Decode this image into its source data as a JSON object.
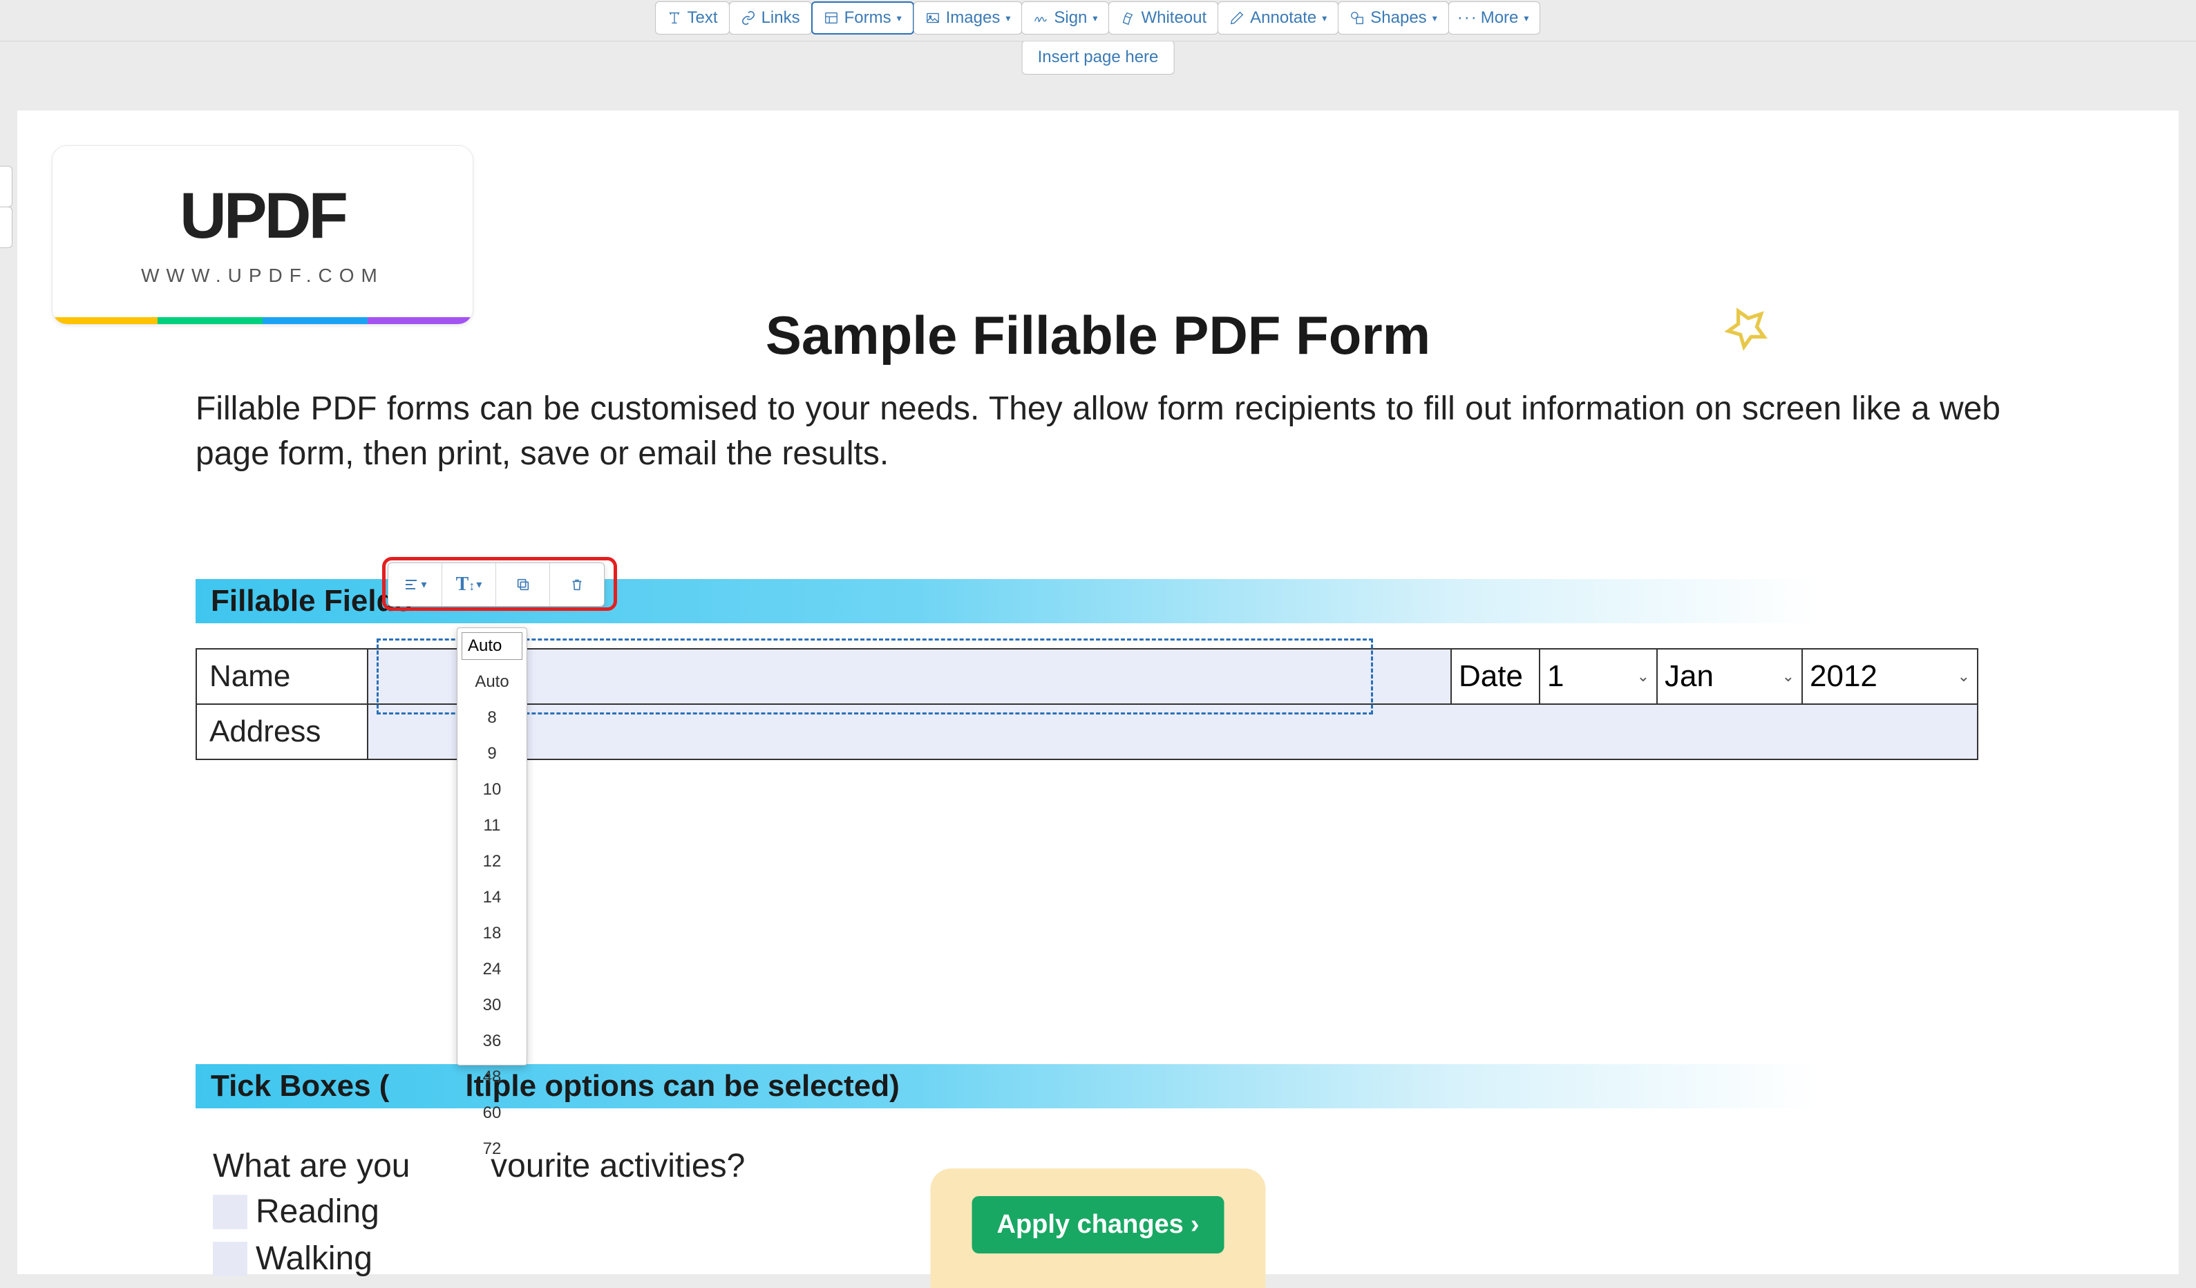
{
  "toolbar": {
    "text": "Text",
    "links": "Links",
    "forms": "Forms",
    "images": "Images",
    "sign": "Sign",
    "whiteout": "Whiteout",
    "annotate": "Annotate",
    "shapes": "Shapes",
    "more": "More"
  },
  "insert_page": "Insert page here",
  "logo": {
    "brand": "UPDF",
    "url": "WWW.UPDF.COM",
    "stripe_colors": [
      "#ffc200",
      "#00d07e",
      "#1aa3f4",
      "#a353f0"
    ]
  },
  "document": {
    "title": "Sample Fillable PDF Form",
    "intro": "Fillable PDF forms can be customised to your needs. They allow form recipients to fill out information on screen like a web page form, then print, save or email the results."
  },
  "sections": {
    "fillable": "Fillable Fields",
    "tick": "Tick Boxes (Multiple options can be selected)"
  },
  "section_visible": {
    "tick_partial": "Tick Boxes (",
    "tick_rest": "ltiple options can be selected)"
  },
  "form": {
    "name_label": "Name",
    "date_label": "Date",
    "day": "1",
    "month": "Jan",
    "year": "2012",
    "address_label": "Address"
  },
  "size_dropdown": {
    "input_value": "Auto",
    "options": [
      "Auto",
      "8",
      "9",
      "10",
      "11",
      "12",
      "14",
      "18",
      "24",
      "30",
      "36",
      "48",
      "60",
      "72"
    ]
  },
  "tick_section": {
    "question_partial_left": "What are you",
    "question_partial_right": "vourite activities?",
    "opt1": "Reading",
    "opt2": "Walking"
  },
  "apply_button": "Apply changes"
}
